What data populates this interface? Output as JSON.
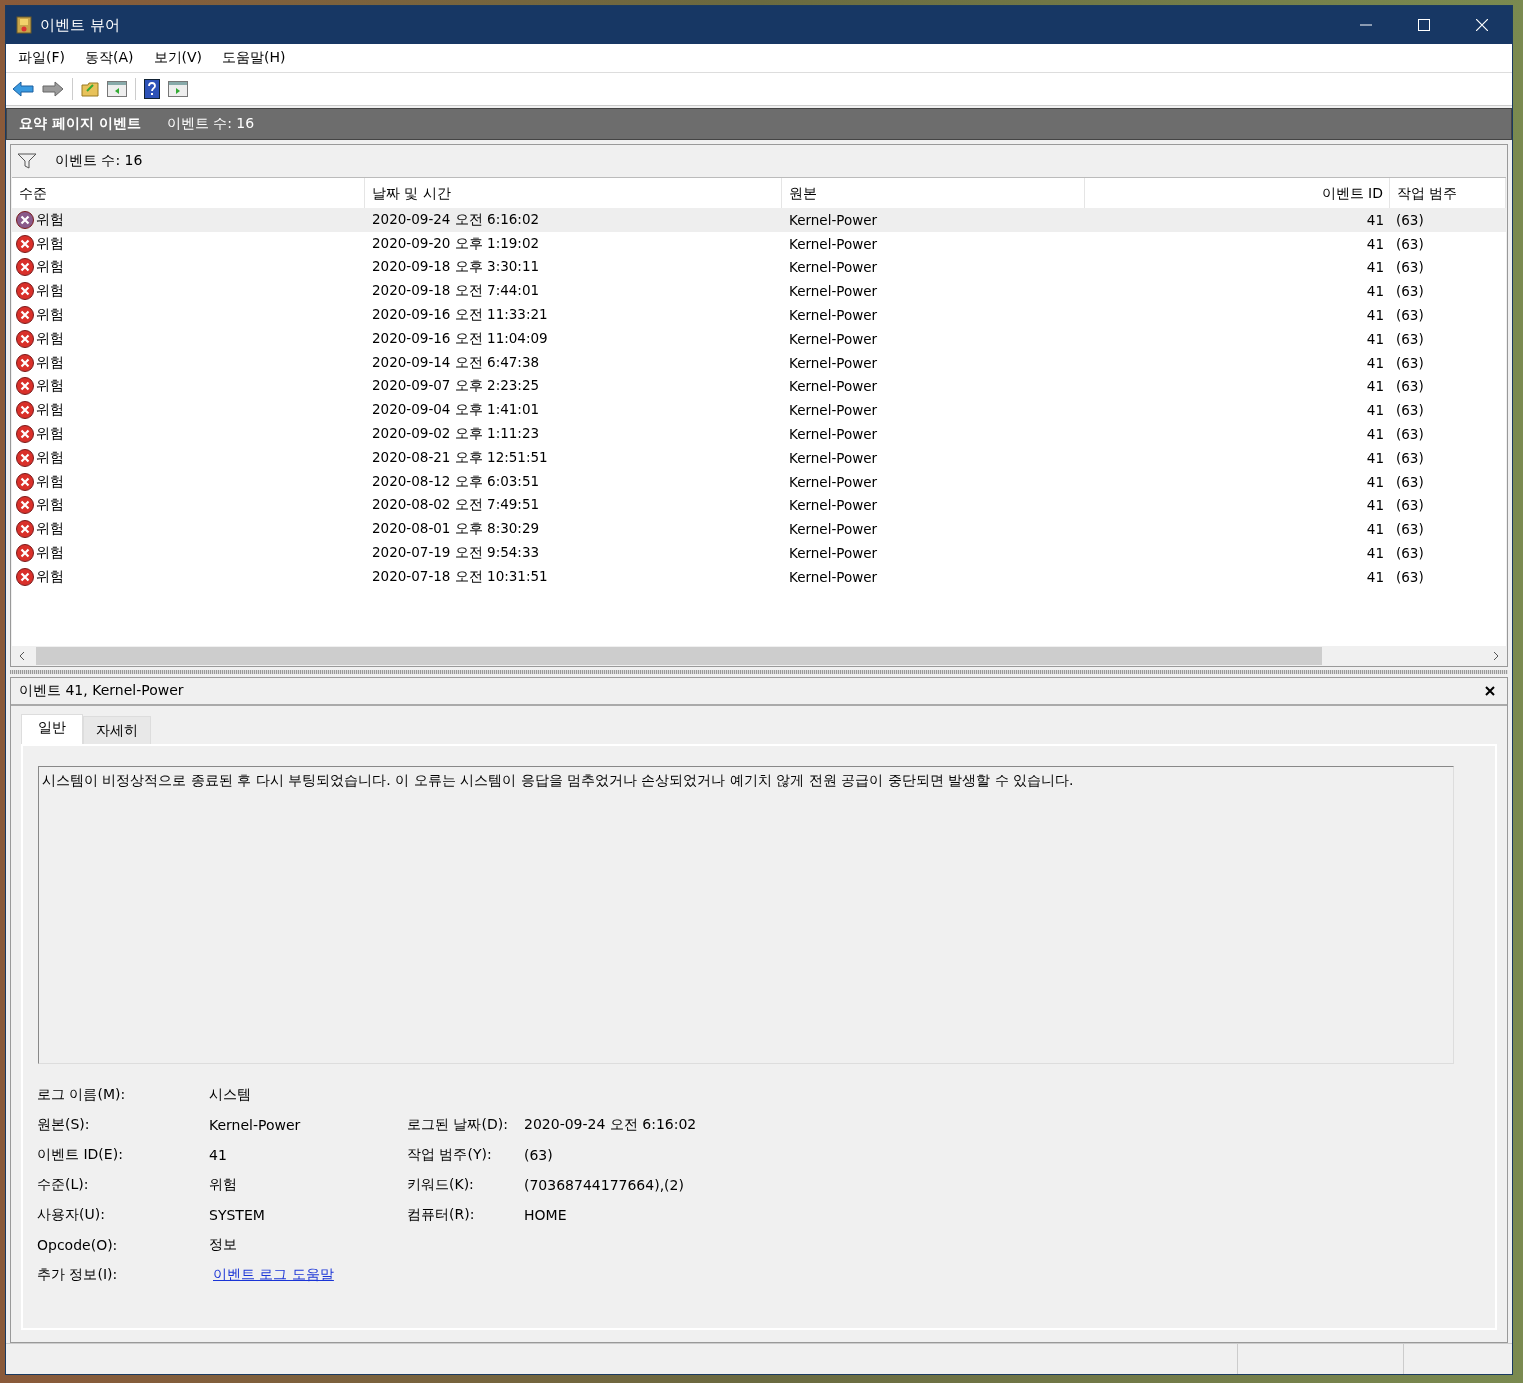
{
  "window": {
    "title": "이벤트 뷰어"
  },
  "menu": [
    "파일(F)",
    "동작(A)",
    "보기(V)",
    "도움말(H)"
  ],
  "header": {
    "title": "요약 페이지 이벤트",
    "count": "이벤트 수: 16"
  },
  "filter": {
    "count": "이벤트 수: 16"
  },
  "table": {
    "columns": [
      "수준",
      "날짜 및 시간",
      "원본",
      "이벤트 ID",
      "작업 범주"
    ],
    "rows": [
      {
        "level": "위험",
        "date": "2020-09-24 오전 6:16:02",
        "source": "Kernel-Power",
        "id": "41",
        "category": "(63)",
        "selected": true
      },
      {
        "level": "위험",
        "date": "2020-09-20 오후 1:19:02",
        "source": "Kernel-Power",
        "id": "41",
        "category": "(63)",
        "selected": false
      },
      {
        "level": "위험",
        "date": "2020-09-18 오후 3:30:11",
        "source": "Kernel-Power",
        "id": "41",
        "category": "(63)",
        "selected": false
      },
      {
        "level": "위험",
        "date": "2020-09-18 오전 7:44:01",
        "source": "Kernel-Power",
        "id": "41",
        "category": "(63)",
        "selected": false
      },
      {
        "level": "위험",
        "date": "2020-09-16 오전 11:33:21",
        "source": "Kernel-Power",
        "id": "41",
        "category": "(63)",
        "selected": false
      },
      {
        "level": "위험",
        "date": "2020-09-16 오전 11:04:09",
        "source": "Kernel-Power",
        "id": "41",
        "category": "(63)",
        "selected": false
      },
      {
        "level": "위험",
        "date": "2020-09-14 오전 6:47:38",
        "source": "Kernel-Power",
        "id": "41",
        "category": "(63)",
        "selected": false
      },
      {
        "level": "위험",
        "date": "2020-09-07 오후 2:23:25",
        "source": "Kernel-Power",
        "id": "41",
        "category": "(63)",
        "selected": false
      },
      {
        "level": "위험",
        "date": "2020-09-04 오후 1:41:01",
        "source": "Kernel-Power",
        "id": "41",
        "category": "(63)",
        "selected": false
      },
      {
        "level": "위험",
        "date": "2020-09-02 오후 1:11:23",
        "source": "Kernel-Power",
        "id": "41",
        "category": "(63)",
        "selected": false
      },
      {
        "level": "위험",
        "date": "2020-08-21 오후 12:51:51",
        "source": "Kernel-Power",
        "id": "41",
        "category": "(63)",
        "selected": false
      },
      {
        "level": "위험",
        "date": "2020-08-12 오후 6:03:51",
        "source": "Kernel-Power",
        "id": "41",
        "category": "(63)",
        "selected": false
      },
      {
        "level": "위험",
        "date": "2020-08-02 오전 7:49:51",
        "source": "Kernel-Power",
        "id": "41",
        "category": "(63)",
        "selected": false
      },
      {
        "level": "위험",
        "date": "2020-08-01 오후 8:30:29",
        "source": "Kernel-Power",
        "id": "41",
        "category": "(63)",
        "selected": false
      },
      {
        "level": "위험",
        "date": "2020-07-19 오전 9:54:33",
        "source": "Kernel-Power",
        "id": "41",
        "category": "(63)",
        "selected": false
      },
      {
        "level": "위험",
        "date": "2020-07-18 오전 10:31:51",
        "source": "Kernel-Power",
        "id": "41",
        "category": "(63)",
        "selected": false
      }
    ]
  },
  "detail": {
    "title": "이벤트 41, Kernel-Power",
    "tabs": [
      {
        "label": "일반",
        "selected": true
      },
      {
        "label": "자세히",
        "selected": false
      }
    ],
    "description": "시스템이 비정상적으로 종료된 후 다시 부팅되었습니다. 이 오류는 시스템이 응답을 멈추었거나 손상되었거나 예기치 않게 전원 공급이 중단되면 발생할 수 있습니다.",
    "rows": [
      {
        "left": {
          "label": "로그 이름(M):",
          "value": "시스템"
        }
      },
      {
        "left": {
          "label": "원본(S):",
          "value": "Kernel-Power"
        },
        "right": {
          "label": "로그된 날짜(D):",
          "value": "2020-09-24 오전 6:16:02"
        }
      },
      {
        "left": {
          "label": "이벤트 ID(E):",
          "value": "41"
        },
        "right": {
          "label": "작업 범주(Y):",
          "value": "(63)"
        }
      },
      {
        "left": {
          "label": "수준(L):",
          "value": "위험"
        },
        "right": {
          "label": "키워드(K):",
          "value": "(70368744177664),(2)"
        }
      },
      {
        "left": {
          "label": "사용자(U):",
          "value": "SYSTEM"
        },
        "right": {
          "label": "컴퓨터(R):",
          "value": "HOME"
        }
      },
      {
        "left": {
          "label": "Opcode(O):",
          "value": "정보"
        }
      },
      {
        "left": {
          "label": "추가 정보(I):",
          "value": "이벤트 로그 도움말",
          "kind": "link"
        }
      }
    ]
  }
}
